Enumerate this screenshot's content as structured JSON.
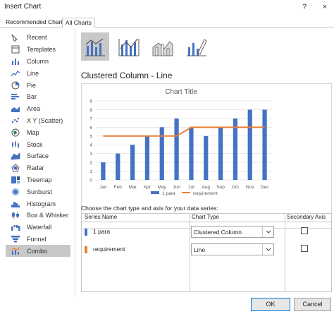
{
  "window": {
    "title": "Insert Chart",
    "help_icon": "?",
    "close_icon": "×"
  },
  "tabs": [
    {
      "label": "Recommended Charts",
      "active": false
    },
    {
      "label": "All Charts",
      "active": true
    }
  ],
  "sidebar": {
    "items": [
      {
        "label": "Recent",
        "icon": "recent-icon"
      },
      {
        "label": "Templates",
        "icon": "templates-icon"
      },
      {
        "label": "Column",
        "icon": "column-chart-icon"
      },
      {
        "label": "Line",
        "icon": "line-chart-icon"
      },
      {
        "label": "Pie",
        "icon": "pie-chart-icon"
      },
      {
        "label": "Bar",
        "icon": "bar-chart-icon"
      },
      {
        "label": "Area",
        "icon": "area-chart-icon"
      },
      {
        "label": "X Y (Scatter)",
        "icon": "scatter-chart-icon"
      },
      {
        "label": "Map",
        "icon": "map-chart-icon"
      },
      {
        "label": "Stock",
        "icon": "stock-chart-icon"
      },
      {
        "label": "Surface",
        "icon": "surface-chart-icon"
      },
      {
        "label": "Radar",
        "icon": "radar-chart-icon"
      },
      {
        "label": "Treemap",
        "icon": "treemap-chart-icon"
      },
      {
        "label": "Sunburst",
        "icon": "sunburst-chart-icon"
      },
      {
        "label": "Histogram",
        "icon": "histogram-chart-icon"
      },
      {
        "label": "Box & Whisker",
        "icon": "box-whisker-chart-icon"
      },
      {
        "label": "Waterfall",
        "icon": "waterfall-chart-icon"
      },
      {
        "label": "Funnel",
        "icon": "funnel-chart-icon"
      },
      {
        "label": "Combo",
        "icon": "combo-chart-icon",
        "selected": true
      }
    ]
  },
  "subtypes": [
    {
      "icon": "clustered-column-line-icon",
      "selected": true
    },
    {
      "icon": "clustered-column-line-secondary-axis-icon",
      "selected": false
    },
    {
      "icon": "stacked-area-clustered-column-icon",
      "selected": false
    },
    {
      "icon": "custom-combination-icon",
      "selected": false
    }
  ],
  "chart_type_title": "Clustered Column - Line",
  "chart_data": {
    "type": "bar",
    "title": "Chart Title",
    "categories": [
      "Jan",
      "Feb",
      "Mar",
      "Apr",
      "May",
      "Jun",
      "Jul",
      "Aug",
      "Sep",
      "Oct",
      "Nov",
      "Dec"
    ],
    "series": [
      {
        "name": "1 para",
        "type": "bar",
        "color": "#4472C4",
        "values": [
          2,
          3,
          4,
          5,
          6,
          7,
          6,
          5,
          6,
          7,
          8,
          8
        ]
      },
      {
        "name": "requirement",
        "type": "line",
        "color": "#ED7D31",
        "values": [
          5,
          5,
          5,
          5,
          5,
          5,
          6,
          6,
          6,
          6,
          6,
          6
        ]
      }
    ],
    "y_ticks": [
      "0",
      "1",
      "2",
      "3",
      "4",
      "5",
      "6",
      "7",
      "8",
      "9"
    ],
    "ylim": [
      0,
      9
    ],
    "grid": true,
    "legend": "bottom"
  },
  "series_section": {
    "label": "Choose the chart type and axis for your data series:",
    "headers": {
      "series_name": "Series Name",
      "chart_type": "Chart Type",
      "secondary_axis": "Secondary Axis"
    },
    "rows": [
      {
        "name": "1 para",
        "color": "#4472C4",
        "chart_type": "Clustered Column",
        "secondary_axis": false
      },
      {
        "name": "requirement",
        "color": "#ED7D31",
        "chart_type": "Line",
        "secondary_axis": false
      }
    ]
  },
  "buttons": {
    "ok": "OK",
    "cancel": "Cancel"
  }
}
